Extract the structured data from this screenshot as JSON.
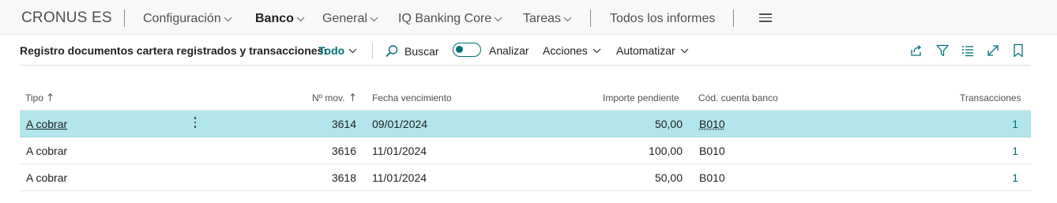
{
  "company": "CRONUS ES",
  "nav": {
    "items": [
      {
        "label": "Configuración",
        "has_chevron": true
      },
      {
        "label": "Banco",
        "has_chevron": true,
        "active": true
      },
      {
        "label": "General",
        "has_chevron": true
      },
      {
        "label": "IQ Banking Core",
        "has_chevron": true
      },
      {
        "label": "Tareas",
        "has_chevron": true
      }
    ],
    "all_reports": "Todos los informes",
    "menu_icon": "hamburger-icon"
  },
  "actionbar": {
    "page_title": "Registro documentos cartera registrados y transacciones:",
    "view_filter": "Todo",
    "search_label": "Buscar",
    "analyze_label": "Analizar",
    "analyze_toggle_on": false,
    "actions_label": "Acciones",
    "automate_label": "Automatizar",
    "right_icons": [
      "share-icon",
      "filter-icon",
      "list-view-icon",
      "expand-icon",
      "bookmark-icon"
    ]
  },
  "table": {
    "columns": {
      "tipo": "Tipo",
      "num_mov": "Nº mov.",
      "fecha": "Fecha vencimiento",
      "importe": "Importe pendiente",
      "cuenta": "Cód. cuenta banco",
      "transacciones": "Transacciones"
    },
    "rows": [
      {
        "tipo": "A cobrar",
        "num_mov": "3614",
        "fecha": "09/01/2024",
        "importe": "50,00",
        "cuenta": "B010",
        "transacciones": "1",
        "selected": true
      },
      {
        "tipo": "A cobrar",
        "num_mov": "3616",
        "fecha": "11/01/2024",
        "importe": "100,00",
        "cuenta": "B010",
        "transacciones": "1",
        "selected": false
      },
      {
        "tipo": "A cobrar",
        "num_mov": "3618",
        "fecha": "11/01/2024",
        "importe": "50,00",
        "cuenta": "B010",
        "transacciones": "1",
        "selected": false
      }
    ]
  },
  "colors": {
    "accent": "#00707a",
    "selected_row": "#b2e6ea",
    "nav_background": "#f8f8f8"
  }
}
